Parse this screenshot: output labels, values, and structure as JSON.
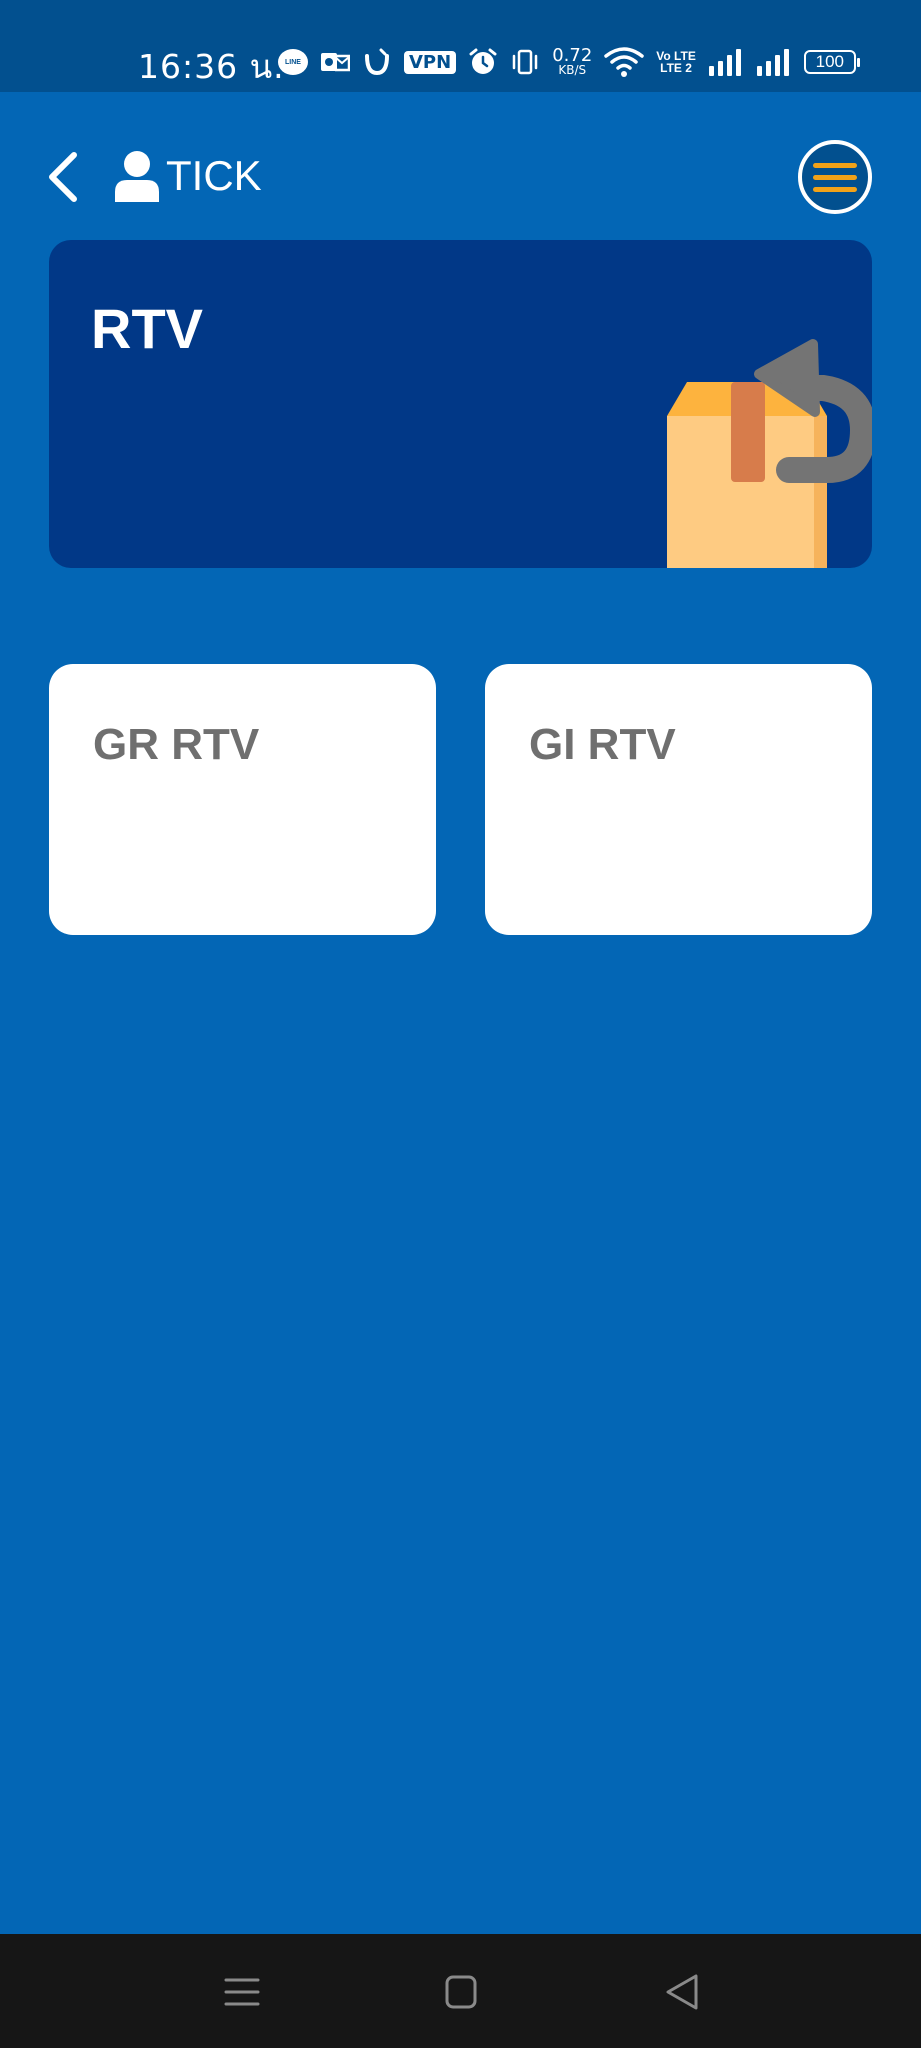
{
  "status_bar": {
    "time": "16:36 น.",
    "line_label": "LINE",
    "vpn_label": "VPN",
    "speed_value": "0.72",
    "speed_unit": "KB/S",
    "volte_top": "Vo LTE",
    "volte_bottom": "LTE 2",
    "battery": "100",
    "icons": [
      "line-icon",
      "outlook-icon",
      "app-icon",
      "vpn-icon",
      "alarm-icon",
      "vibrate-icon",
      "wifi-icon",
      "signal-icon",
      "signal-icon",
      "battery-icon"
    ]
  },
  "header": {
    "user_name": "TICK",
    "icons": {
      "back": "chevron-left-icon",
      "user": "user-icon",
      "menu": "hamburger-menu-icon"
    },
    "colors": {
      "menu_bars": "#f2a218"
    }
  },
  "banner": {
    "title": "RTV",
    "illustration": "return-box-icon",
    "background": "#013887"
  },
  "cards": [
    {
      "label": "GR RTV"
    },
    {
      "label": "GI RTV"
    }
  ],
  "nav_bar": {
    "icons": [
      "recents-icon",
      "home-icon",
      "back-triangle-icon"
    ]
  },
  "colors": {
    "page_background": "#0366b5",
    "status_bar_background": "#02508f",
    "card_text": "#6f6f6f"
  }
}
